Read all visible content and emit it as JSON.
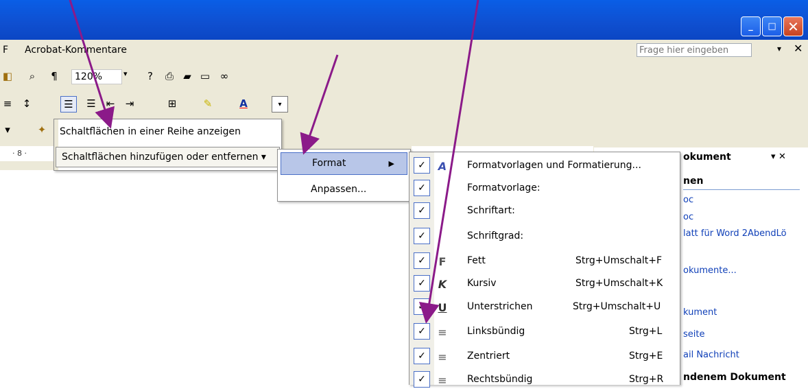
{
  "window": {
    "min_label": "_",
    "max_label": "□",
    "close_label": "✕"
  },
  "menubar": {
    "items": [
      "F",
      "Acrobat-Kommentare"
    ]
  },
  "help": {
    "placeholder": "Frage hier eingeben",
    "drop": "▾",
    "close": "✕"
  },
  "toolbar": {
    "zoom": "120%",
    "zoom_drop": "▾"
  },
  "ruler": {
    "text": "· 8 ·"
  },
  "menu1": {
    "show_one_row": "Schaltflächen in einer Reihe anzeigen",
    "add_remove": "Schaltflächen hinzufügen oder entfernen ▾"
  },
  "menu2": {
    "format": "Format",
    "format_arrow": "▶",
    "customize": "Anpassen..."
  },
  "format_menu": {
    "items": [
      {
        "label": "Formatvorlagen und Formatierung...",
        "shortcut": ""
      },
      {
        "label": "Formatvorlage:",
        "shortcut": ""
      },
      {
        "label": "Schriftart:",
        "shortcut": ""
      },
      {
        "label": "Schriftgrad:",
        "shortcut": ""
      },
      {
        "label": "Fett",
        "shortcut": "Strg+Umschalt+F"
      },
      {
        "label": "Kursiv",
        "shortcut": "Strg+Umschalt+K"
      },
      {
        "label": "Unterstrichen",
        "shortcut": "Strg+Umschalt+U"
      },
      {
        "label": "Linksbündig",
        "shortcut": "Strg+L"
      },
      {
        "label": "Zentriert",
        "shortcut": "Strg+E"
      },
      {
        "label": "Rechtsbündig",
        "shortcut": "Strg+R"
      }
    ],
    "check": "✓"
  },
  "taskpane": {
    "title": "okument",
    "title_icons": "▾ ✕",
    "section1": "nen",
    "links": [
      "oc",
      "oc",
      "latt für Word 2AbendLö",
      "okumente...",
      "kument",
      "seite",
      "ail Nachricht"
    ],
    "section2": "ndenem Dokument"
  },
  "colors": {
    "title_bar": "#0f4fd0",
    "menu_bg": "#ece9d8",
    "highlight": "#b8c6e8",
    "arrow": "#8b1a89",
    "link": "#1040b8"
  }
}
